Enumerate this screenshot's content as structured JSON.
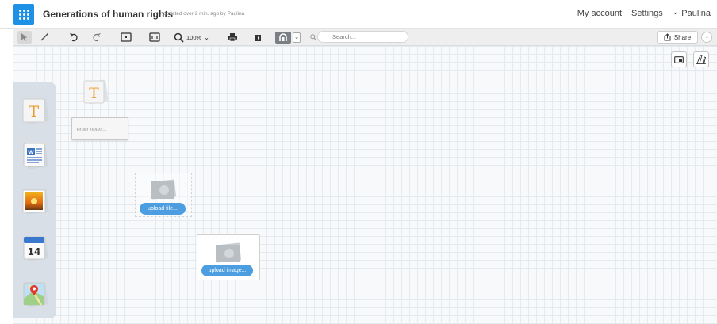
{
  "header": {
    "doc_title": "Generations of human rights",
    "updated": "updated over 2 min. ago by Paulina",
    "nav": {
      "account": "My account",
      "settings": "Settings",
      "user": "Paulina"
    }
  },
  "toolbar": {
    "zoom": "100%",
    "search_placeholder": "Search...",
    "share_label": "Share"
  },
  "canvas": {
    "note_placeholder": "enter notes...",
    "upload_file_label": "upload file...",
    "upload_image_label": "upload image..."
  },
  "dock": {
    "items": [
      "text-tool",
      "document-tool",
      "image-tool",
      "calendar-tool",
      "map-tool"
    ],
    "calendar_day": "14"
  },
  "colors": {
    "accent": "#1e90e6",
    "pill": "#4c9ee0"
  }
}
